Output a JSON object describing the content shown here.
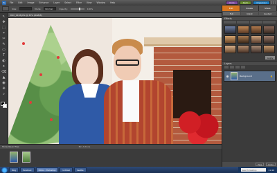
{
  "menubar": {
    "items": [
      "File",
      "Edit",
      "Image",
      "Enhance",
      "Layer",
      "Select",
      "Filter",
      "View",
      "Window",
      "Help"
    ],
    "buttons": {
      "undo": "Undo",
      "redo": "Redo",
      "create": "Create",
      "share": "Organizer"
    }
  },
  "options": {
    "size_label": "Size:",
    "size_value": "",
    "mode_label": "Mode:",
    "mode_value": "Normal",
    "opacity_label": "Opacity:",
    "opacity_value": "100%"
  },
  "document": {
    "tab_title": "DSC_0193.JPG @ 33% (RGB/8)"
  },
  "toolbox": {
    "tools": [
      "↖",
      "✥",
      "⬚",
      "⌖",
      "✂",
      "✎",
      "▭",
      "T",
      "◐",
      "✦",
      "⌫",
      "▲",
      "◉",
      "⊕",
      "⌕"
    ],
    "foreground": "#000000",
    "background": "#ffffff"
  },
  "bin": {
    "title": "Show Open Files",
    "subtitle": "Bin Actions"
  },
  "panel": {
    "modes": [
      "Edit",
      "Create",
      "Share"
    ],
    "subtabs": [
      "Full",
      "Quick",
      "Guided"
    ],
    "effects_header": "Effects",
    "filter_dropdown": "Filters",
    "apply_label": "Apply",
    "layers_header": "Layers",
    "layer_name": "Background",
    "layer_lock": "🔒",
    "footer_btns": [
      "Tips",
      "Undo"
    ]
  },
  "taskbar": {
    "items": [
      "Blog",
      "Facebook",
      "Editor - Photoshop",
      "Untitled",
      "Seattle"
    ],
    "search_placeholder": "Search Desktop",
    "clock": "11:49"
  },
  "colors": {
    "accent_edit": "#d7761f",
    "panel_bg": "#3b3b3b"
  }
}
